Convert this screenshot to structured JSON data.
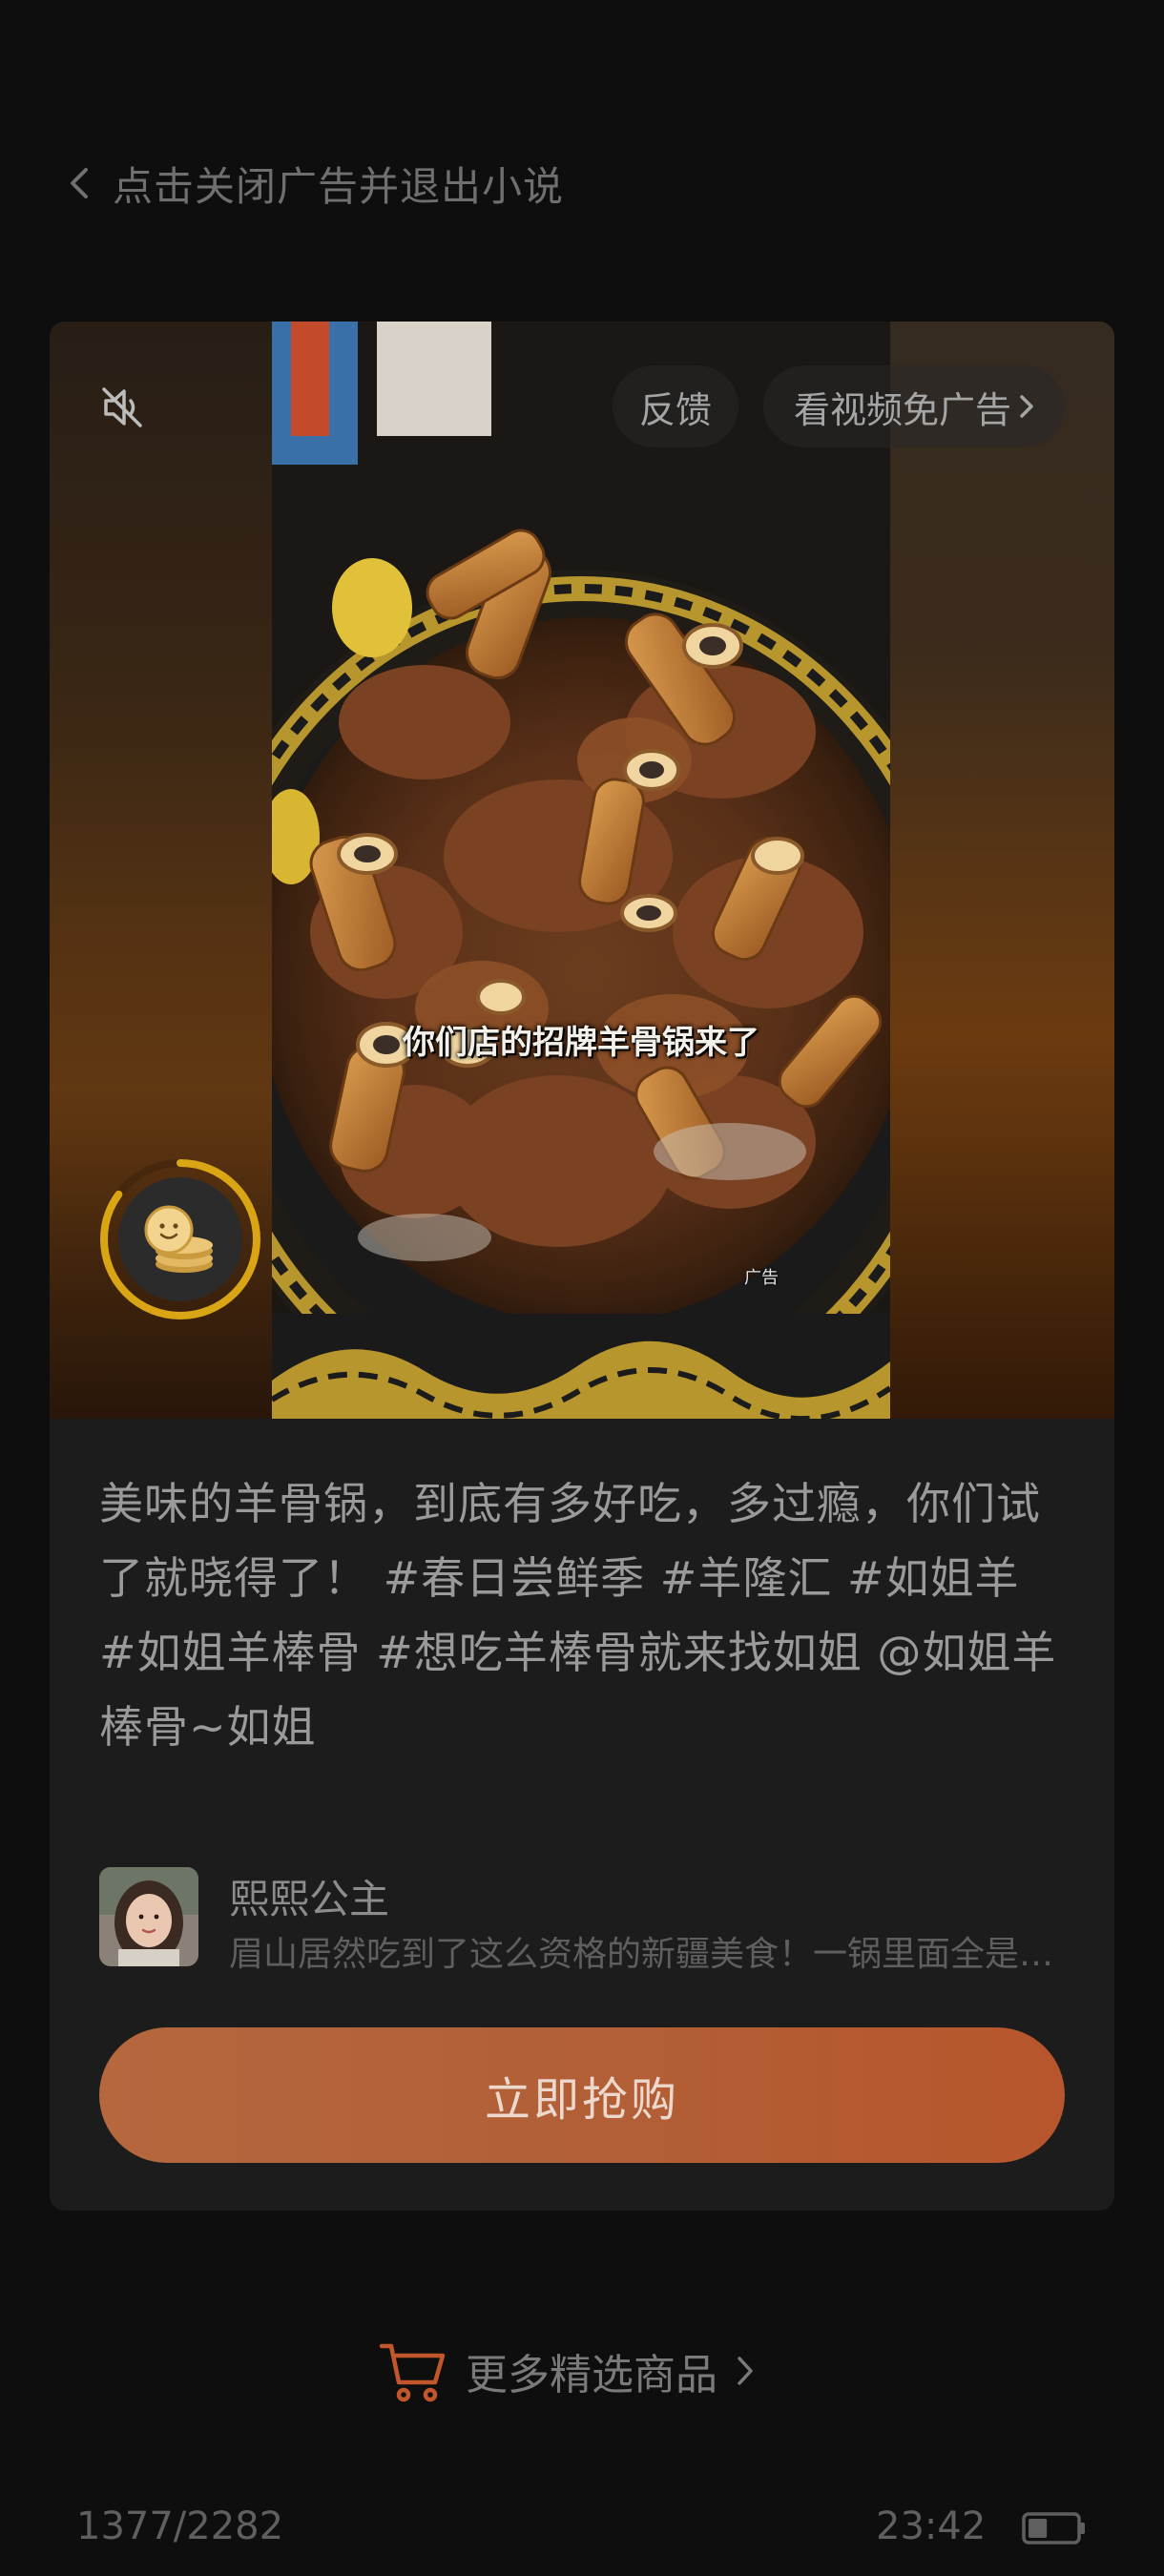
{
  "topbar": {
    "close_label": "点击关闭广告并退出小说",
    "back_icon": "chevron-left-icon"
  },
  "ad": {
    "feedback_label": "反馈",
    "skip_label": "看视频免广告",
    "subtitle": "你们店的招牌羊骨锅来了",
    "ad_tag": "广告",
    "mute_icon": "speaker-muted-icon",
    "timer_progress": 0.85,
    "caption": "美味的羊骨锅，到底有多好吃，多过瘾，你们试了就晓得了！ #春日尝鲜季 #羊隆汇 #如姐羊 #如姐羊棒骨 #想吃羊棒骨就来找如姐 @如姐羊棒骨~如姐",
    "comment": {
      "username": "熙熙公主",
      "text": "眉山居然吃到了这么资格的新疆美食！一锅里面全是大棒骨，啃起来太过瘾了"
    },
    "buy_label": "立即抢购"
  },
  "more": {
    "label": "更多精选商品",
    "icon": "cart-icon",
    "accent": "#c1562b"
  },
  "status": {
    "progress": "1377/2282",
    "time": "23:42",
    "battery_level": 0.4
  }
}
